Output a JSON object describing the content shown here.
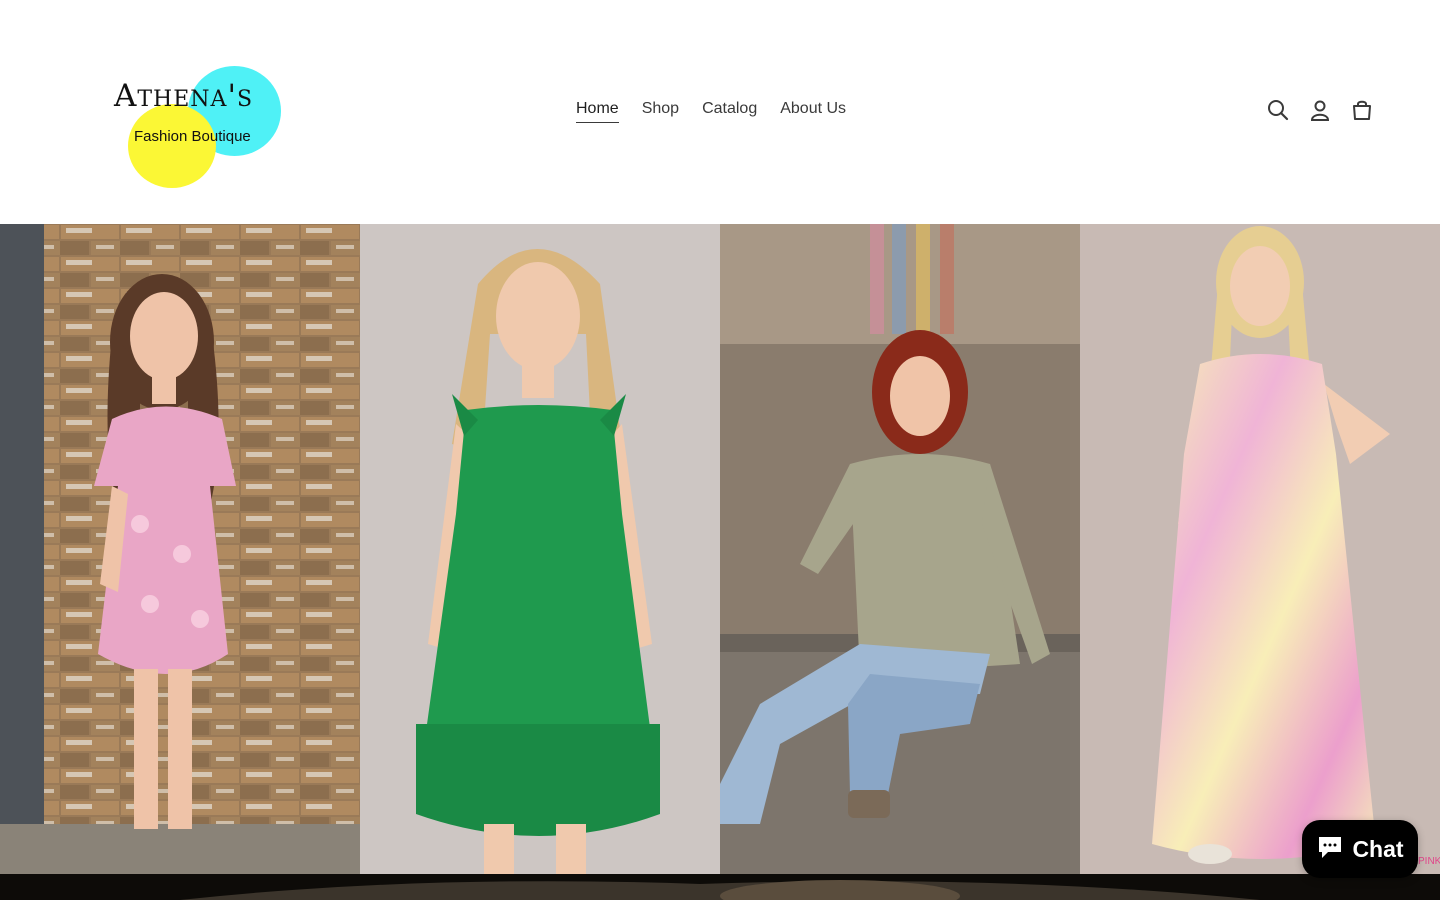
{
  "logo": {
    "title": "Athena's",
    "subtitle": "Fashion Boutique"
  },
  "nav": {
    "items": [
      "Home",
      "Shop",
      "Catalog",
      "About Us"
    ],
    "active": "Home"
  },
  "header_icons": [
    "search-icon",
    "account-icon",
    "cart-icon"
  ],
  "gallery": {
    "tiles": [
      {
        "name": "pink-floral-dress-photo",
        "dress_color": "#e9a6c6",
        "bg_color": "#8a6a4a"
      },
      {
        "name": "green-ruffle-dress-photo",
        "dress_color": "#1f9a4e",
        "bg_color": "#cfc7c4"
      },
      {
        "name": "sage-top-jeans-photo",
        "dress_color": "#a7a58c",
        "bg_color": "#8b7d6e"
      },
      {
        "name": "tie-dye-maxi-dress-photo",
        "dress_color": "#f0b4d6",
        "bg_color": "#c7b9b3"
      }
    ]
  },
  "chat": {
    "label": "Chat",
    "icon": "chat-bubble-icon"
  },
  "colors": {
    "accent_cyan": "#4ff1f6",
    "accent_yellow": "#fbf735",
    "text": "#3a3a3a"
  }
}
